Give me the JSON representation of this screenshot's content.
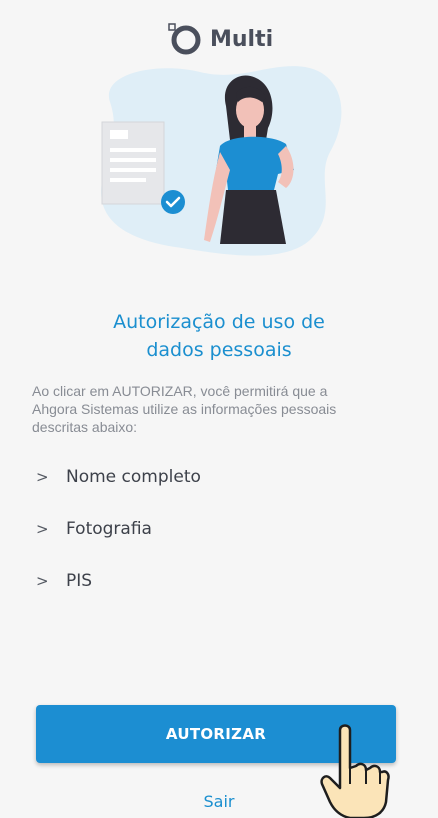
{
  "header": {
    "app_name": "Multi"
  },
  "content": {
    "title_line1": "Autorização de uso de",
    "title_line2": "dados pessoais",
    "description": "Ao clicar em AUTORIZAR, você permitirá que a Ahgora Sistemas utilize as informações pessoais descritas abaixo:",
    "permissions": [
      {
        "marker": ">",
        "label": "Nome completo"
      },
      {
        "marker": ">",
        "label": "Fotografia"
      },
      {
        "marker": ">",
        "label": "PIS"
      }
    ]
  },
  "actions": {
    "authorize_label": "AUTORIZAR",
    "exit_label": "Sair"
  },
  "colors": {
    "accent": "#1c8ed2",
    "background": "#f6f6f6",
    "text_dark": "#3d414a",
    "text_muted": "#888c94"
  },
  "icons": {
    "logo": "multi-logo-icon",
    "chevron": "chevron-right-icon",
    "check": "check-circle-icon",
    "pointer": "pointing-hand-icon"
  }
}
